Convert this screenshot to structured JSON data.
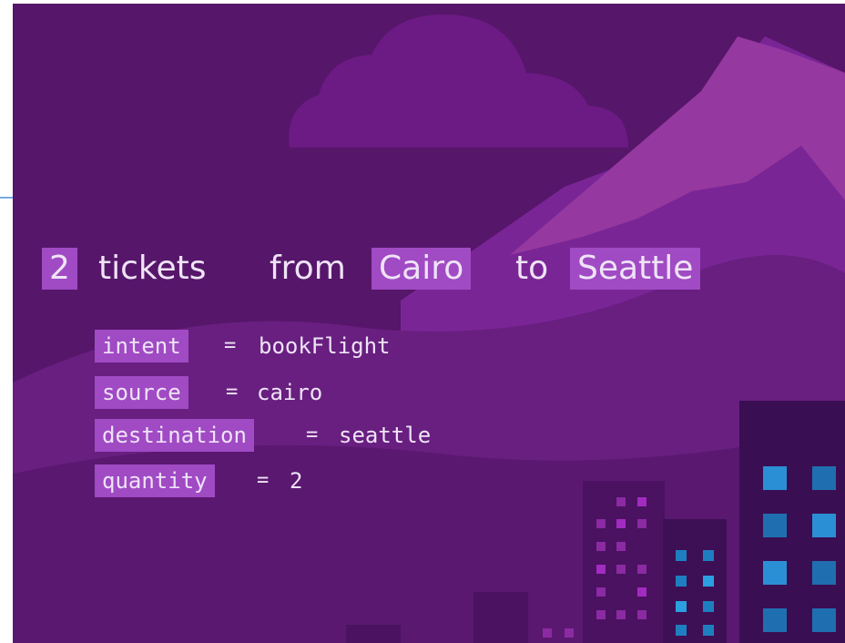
{
  "utterance": {
    "quantity": "2",
    "word_tickets": "tickets",
    "word_from": "from",
    "source": "Cairo",
    "word_to": "to",
    "destination": "Seattle"
  },
  "entities": [
    {
      "key": "intent",
      "equals": "=",
      "value": "bookFlight"
    },
    {
      "key": "source",
      "equals": "=",
      "value": "cairo"
    },
    {
      "key": "destination",
      "equals": "=",
      "value": "seattle"
    },
    {
      "key": "quantity",
      "equals": "=",
      "value": "2"
    }
  ],
  "colors": {
    "background": "#56166a",
    "highlight": "#a04ac4",
    "text": "#efe3f6",
    "accent_line": "#4a8fd6"
  }
}
